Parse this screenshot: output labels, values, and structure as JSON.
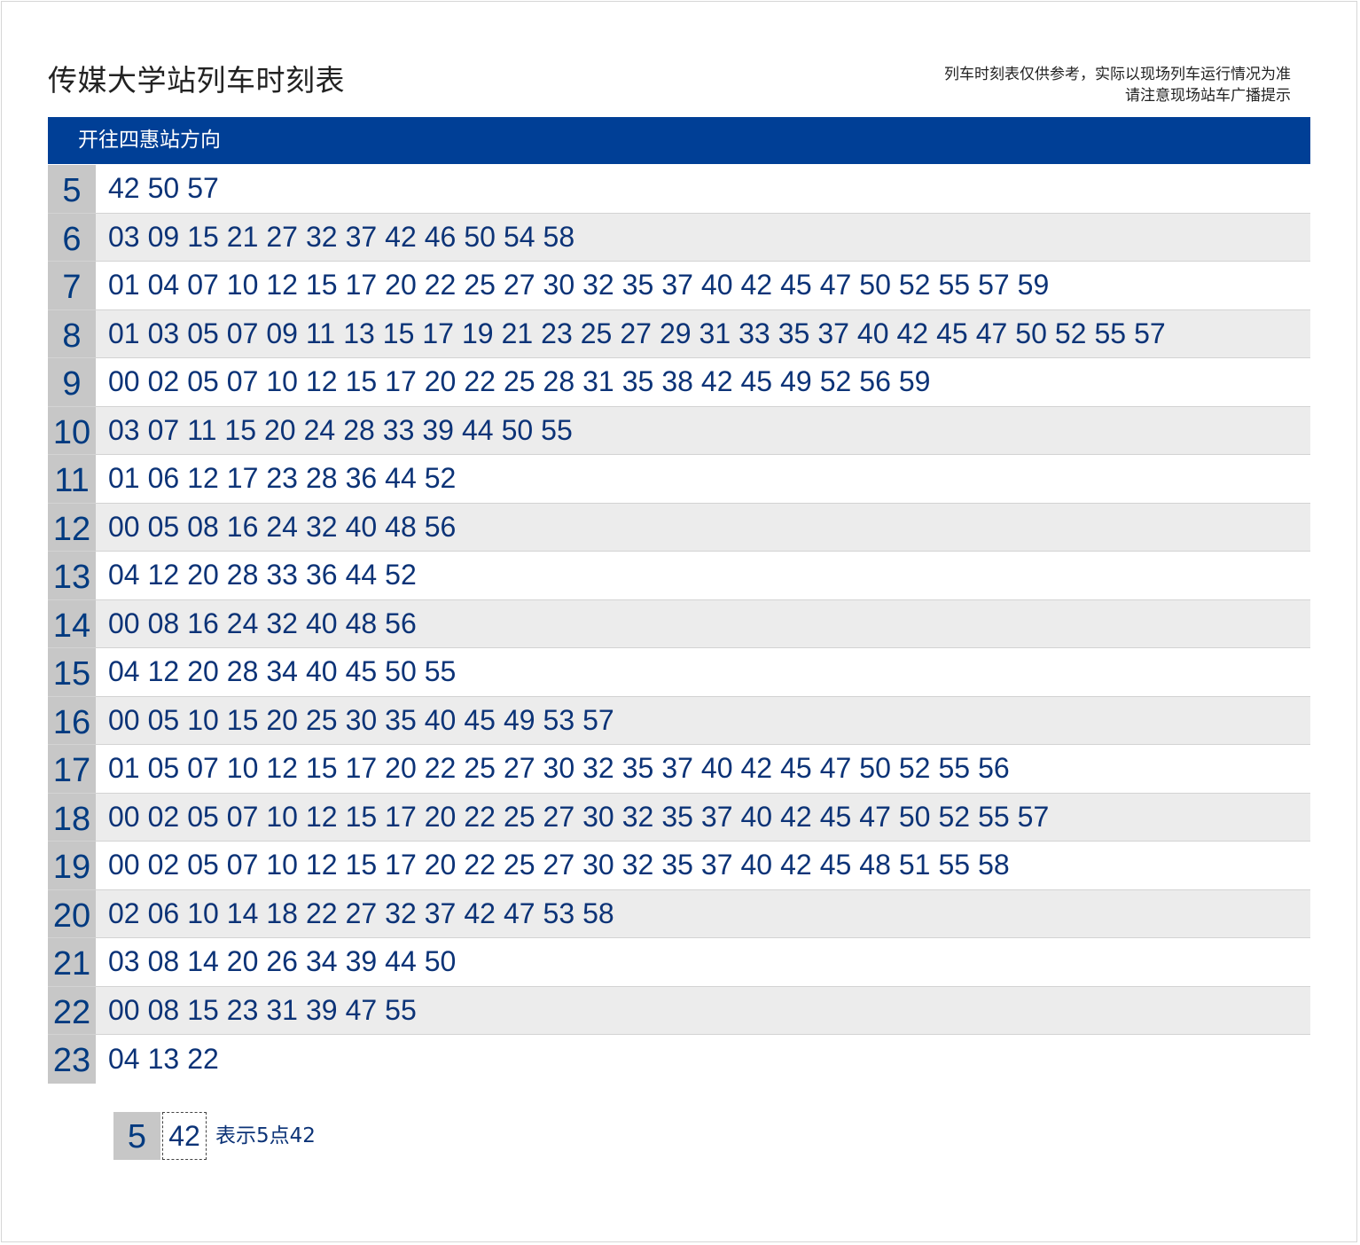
{
  "header": {
    "title": "传媒大学站列车时刻表",
    "note_line1": "列车时刻表仅供参考，实际以现场列车运行情况为准",
    "note_line2": "请注意现场站车广播提示"
  },
  "direction": {
    "label": "开往四惠站方向"
  },
  "schedule": [
    {
      "hour": "5",
      "minutes": [
        "42",
        "50",
        "57"
      ]
    },
    {
      "hour": "6",
      "minutes": [
        "03",
        "09",
        "15",
        "21",
        "27",
        "32",
        "37",
        "42",
        "46",
        "50",
        "54",
        "58"
      ]
    },
    {
      "hour": "7",
      "minutes": [
        "01",
        "04",
        "07",
        "10",
        "12",
        "15",
        "17",
        "20",
        "22",
        "25",
        "27",
        "30",
        "32",
        "35",
        "37",
        "40",
        "42",
        "45",
        "47",
        "50",
        "52",
        "55",
        "57",
        "59"
      ]
    },
    {
      "hour": "8",
      "minutes": [
        "01",
        "03",
        "05",
        "07",
        "09",
        "11",
        "13",
        "15",
        "17",
        "19",
        "21",
        "23",
        "25",
        "27",
        "29",
        "31",
        "33",
        "35",
        "37",
        "40",
        "42",
        "45",
        "47",
        "50",
        "52",
        "55",
        "57"
      ]
    },
    {
      "hour": "9",
      "minutes": [
        "00",
        "02",
        "05",
        "07",
        "10",
        "12",
        "15",
        "17",
        "20",
        "22",
        "25",
        "28",
        "31",
        "35",
        "38",
        "42",
        "45",
        "49",
        "52",
        "56",
        "59"
      ]
    },
    {
      "hour": "10",
      "minutes": [
        "03",
        "07",
        "11",
        "15",
        "20",
        "24",
        "28",
        "33",
        "39",
        "44",
        "50",
        "55"
      ]
    },
    {
      "hour": "11",
      "minutes": [
        "01",
        "06",
        "12",
        "17",
        "23",
        "28",
        "36",
        "44",
        "52"
      ]
    },
    {
      "hour": "12",
      "minutes": [
        "00",
        "05",
        "08",
        "16",
        "24",
        "32",
        "40",
        "48",
        "56"
      ]
    },
    {
      "hour": "13",
      "minutes": [
        "04",
        "12",
        "20",
        "28",
        "33",
        "36",
        "44",
        "52"
      ]
    },
    {
      "hour": "14",
      "minutes": [
        "00",
        "08",
        "16",
        "24",
        "32",
        "40",
        "48",
        "56"
      ]
    },
    {
      "hour": "15",
      "minutes": [
        "04",
        "12",
        "20",
        "28",
        "34",
        "40",
        "45",
        "50",
        "55"
      ]
    },
    {
      "hour": "16",
      "minutes": [
        "00",
        "05",
        "10",
        "15",
        "20",
        "25",
        "30",
        "35",
        "40",
        "45",
        "49",
        "53",
        "57"
      ]
    },
    {
      "hour": "17",
      "minutes": [
        "01",
        "05",
        "07",
        "10",
        "12",
        "15",
        "17",
        "20",
        "22",
        "25",
        "27",
        "30",
        "32",
        "35",
        "37",
        "40",
        "42",
        "45",
        "47",
        "50",
        "52",
        "55",
        "56"
      ]
    },
    {
      "hour": "18",
      "minutes": [
        "00",
        "02",
        "05",
        "07",
        "10",
        "12",
        "15",
        "17",
        "20",
        "22",
        "25",
        "27",
        "30",
        "32",
        "35",
        "37",
        "40",
        "42",
        "45",
        "47",
        "50",
        "52",
        "55",
        "57"
      ]
    },
    {
      "hour": "19",
      "minutes": [
        "00",
        "02",
        "05",
        "07",
        "10",
        "12",
        "15",
        "17",
        "20",
        "22",
        "25",
        "27",
        "30",
        "32",
        "35",
        "37",
        "40",
        "42",
        "45",
        "48",
        "51",
        "55",
        "58"
      ]
    },
    {
      "hour": "20",
      "minutes": [
        "02",
        "06",
        "10",
        "14",
        "18",
        "22",
        "27",
        "32",
        "37",
        "42",
        "47",
        "53",
        "58"
      ]
    },
    {
      "hour": "21",
      "minutes": [
        "03",
        "08",
        "14",
        "20",
        "26",
        "34",
        "39",
        "44",
        "50"
      ]
    },
    {
      "hour": "22",
      "minutes": [
        "00",
        "08",
        "15",
        "23",
        "31",
        "39",
        "47",
        "55"
      ]
    },
    {
      "hour": "23",
      "minutes": [
        "04",
        "13",
        "22"
      ]
    }
  ],
  "legend": {
    "hour": "5",
    "minute": "42",
    "text": "表示5点42"
  },
  "colors": {
    "direction_bar": "#003f96",
    "hour_cell": "#c7c7c7",
    "alt_row": "#ececec",
    "digits": "#0c3377"
  }
}
